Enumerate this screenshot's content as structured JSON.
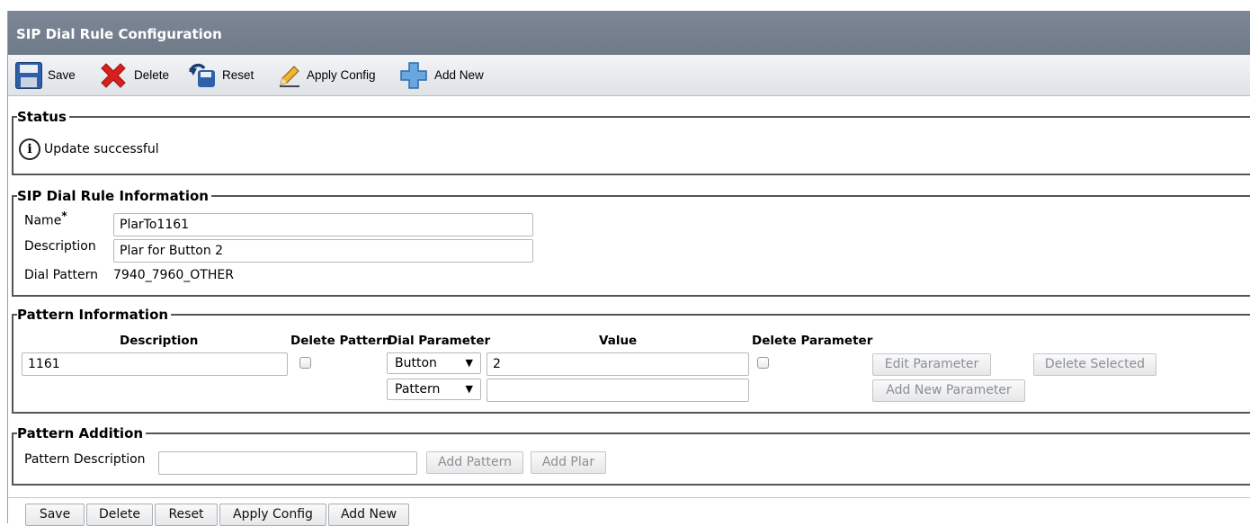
{
  "title": "SIP Dial Rule Configuration",
  "toolbar": {
    "save": "Save",
    "delete": "Delete",
    "reset": "Reset",
    "apply_config": "Apply Config",
    "add_new": "Add New"
  },
  "status": {
    "legend": "Status",
    "message": "Update successful",
    "icon_glyph": "i"
  },
  "rule_info": {
    "legend": "SIP Dial Rule Information",
    "name_label": "Name",
    "required_mark": "*",
    "name_value": "PlarTo1161",
    "description_label": "Description",
    "description_value": "Plar for Button 2",
    "dial_pattern_label": "Dial Pattern",
    "dial_pattern_value": "7940_7960_OTHER"
  },
  "pattern_info": {
    "legend": "Pattern Information",
    "headers": {
      "description": "Description",
      "delete_pattern": "Delete Pattern",
      "dial_parameter": "Dial Parameter",
      "value": "Value",
      "delete_parameter": "Delete Parameter"
    },
    "pattern_description": "1161",
    "parameters": [
      {
        "dial_parameter": "Button",
        "value": "2"
      },
      {
        "dial_parameter": "Pattern",
        "value": ""
      }
    ],
    "edit_parameter": "Edit Parameter",
    "delete_selected": "Delete Selected",
    "add_new_parameter": "Add New Parameter"
  },
  "pattern_addition": {
    "legend": "Pattern Addition",
    "label": "Pattern Description",
    "value": "",
    "add_pattern": "Add Pattern",
    "add_plar": "Add Plar"
  },
  "bottom_buttons": {
    "save": "Save",
    "delete": "Delete",
    "reset": "Reset",
    "apply_config": "Apply Config",
    "add_new": "Add New"
  },
  "colors": {
    "titlebar": "#76808f",
    "delete_icon": "#d61f1f",
    "save_icon": "#2f5fa8",
    "add_icon": "#6aa6e0"
  }
}
